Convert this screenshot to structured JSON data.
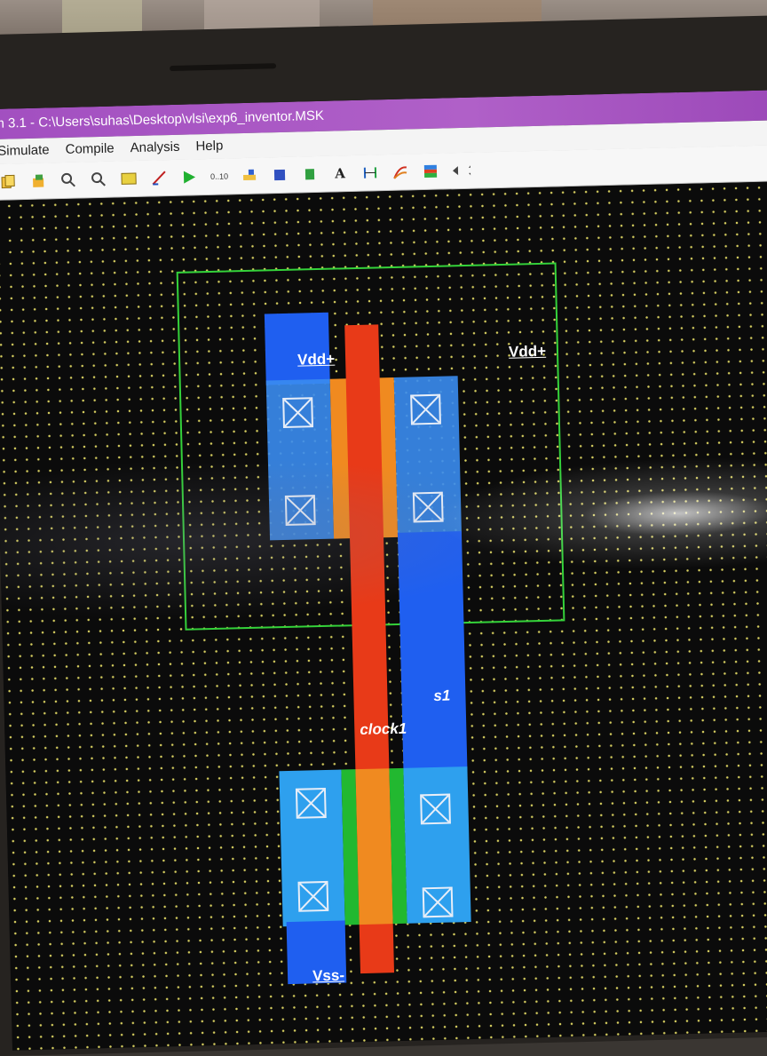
{
  "window": {
    "title": "n 3.1 - C:\\Users\\suhas\\Desktop\\vlsi\\exp6_inventor.MSK"
  },
  "menu": {
    "items": [
      "Simulate",
      "Compile",
      "Analysis",
      "Help"
    ]
  },
  "toolbar": {
    "icons": [
      "copy-icon",
      "layers-icon",
      "zoom-in-icon",
      "zoom-out-icon",
      "fit-icon",
      "edit-icon",
      "run-simulation-icon",
      "timing-icon",
      "connect-icon",
      "chip-icon",
      "component-icon",
      "text-icon",
      "measure-icon",
      "waveform-icon",
      "cross-section-icon",
      "navigate-icon"
    ],
    "timing_label": "0..10",
    "text_label": "A"
  },
  "labels": {
    "vdd_left": "Vdd+",
    "vdd_right": "Vdd+",
    "s1": "s1",
    "clock1": "clock1",
    "vss": "Vss-"
  },
  "colors": {
    "titlebar": "#a24fc0",
    "nwell": "#34d23a",
    "metal": "#1f5ff0",
    "poly": "#e83a18",
    "diffusion": "#2ea0ee",
    "gate_overlap": "#f08a20"
  }
}
